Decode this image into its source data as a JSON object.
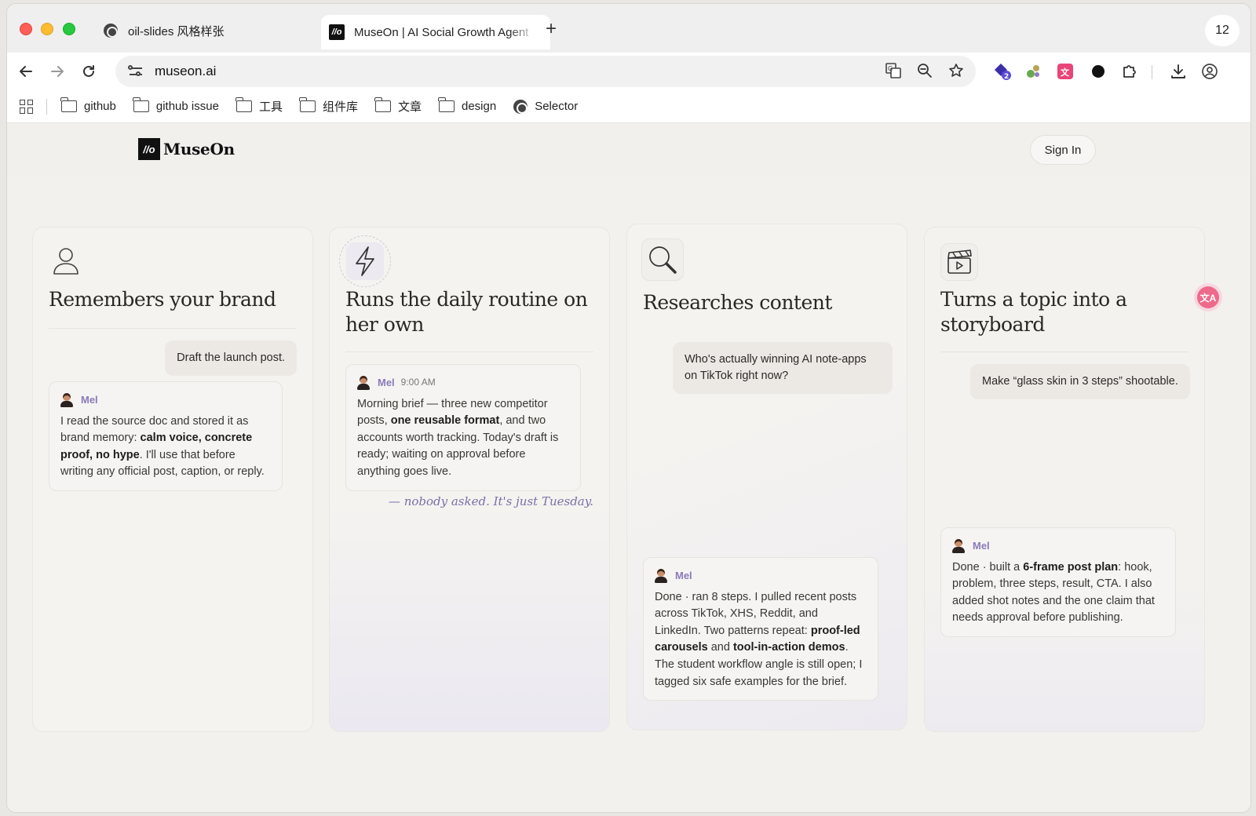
{
  "browser": {
    "tabs": [
      {
        "title": "oil-slides 风格样张"
      },
      {
        "title": "MuseOn | AI Social Growth Agent"
      }
    ],
    "new_tab": "+",
    "tab_count": "12",
    "url": "museon.ai",
    "extension_badge": "2",
    "bookmarks": [
      {
        "label": "github"
      },
      {
        "label": "github issue"
      },
      {
        "label": "工具"
      },
      {
        "label": "组件库"
      },
      {
        "label": "文章"
      },
      {
        "label": "design"
      },
      {
        "label": "Selector"
      }
    ]
  },
  "site": {
    "logo_mark": "//o",
    "brand": "MuseOn",
    "signin": "Sign In"
  },
  "cards": [
    {
      "title": "Remembers your brand",
      "user_message": "Draft the launch post.",
      "bot_name": "Mel",
      "bot_text_1": "I read the source doc and stored it as brand memory: ",
      "bot_bold_1": "calm voice, concrete proof, no hype",
      "bot_text_2": ". I'll use that before writing any official post, caption, or reply."
    },
    {
      "title": "Runs the daily routine on her own",
      "bot_name": "Mel",
      "bot_time": "9:00 AM",
      "bot_text_1": "Morning brief — three new competitor posts, ",
      "bot_bold_1": "one reusable format",
      "bot_text_2": ", and two accounts worth tracking. Today's draft is ready; waiting on approval before anything goes live.",
      "tagline": "— nobody asked. It's just Tuesday."
    },
    {
      "title": "Researches content",
      "user_message": "Who's actually winning AI note-apps on TikTok right now?",
      "bot_name": "Mel",
      "bot_text_1": "Done · ran 8 steps. I pulled recent posts across TikTok, XHS, Reddit, and LinkedIn. Two patterns repeat: ",
      "bot_bold_1": "proof-led carousels",
      "bot_text_2": " and ",
      "bot_bold_2": "tool-in-action demos",
      "bot_text_3": ". The student workflow angle is still open; I tagged six safe examples for the brief."
    },
    {
      "title": "Turns a topic into a storyboard",
      "user_message": "Make “glass skin in 3 steps” shootable.",
      "bot_name": "Mel",
      "bot_text_1": "Done · built a ",
      "bot_bold_1": "6-frame post plan",
      "bot_text_2": ": hook, problem, three steps, result, CTA. I also added shot notes and the one claim that needs approval before publishing."
    }
  ],
  "icons": {
    "card1": "user-icon",
    "card2": "lightning-icon",
    "card3": "magnifier-icon",
    "card4": "clapperboard-icon"
  },
  "colors": {
    "accent": "#8b7ab8",
    "tagline": "#7a6fa8",
    "text": "#2a2724"
  }
}
